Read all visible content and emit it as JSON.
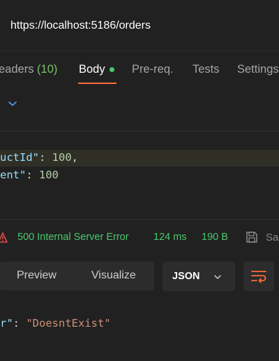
{
  "request": {
    "url": "https://localhost:5186/orders"
  },
  "tabs": [
    {
      "label": "eaders",
      "count": "(10)"
    },
    {
      "label": "Body"
    },
    {
      "label": "Pre-req."
    },
    {
      "label": "Tests"
    },
    {
      "label": "Settings"
    }
  ],
  "request_body": {
    "line1_key": "uctId\"",
    "line1_sep": ": ",
    "line1_value": "100",
    "line1_tail": ",",
    "line2_key": "ent\"",
    "line2_sep": ": ",
    "line2_value": "100"
  },
  "response": {
    "status": "500 Internal Server Error",
    "time": "124 ms",
    "size": "190 B",
    "save_label": "Sa",
    "view_tabs": [
      "Preview",
      "Visualize"
    ],
    "format": "JSON",
    "body_key": "r\"",
    "body_sep": ": ",
    "body_value": "\"DoesntExist\""
  },
  "colors": {
    "accent": "#ff6c37",
    "success": "#49c86b",
    "error": "#e04a4a"
  },
  "icons": {
    "expand": "chevron-down-icon",
    "status": "error-warning-icon",
    "save": "save-icon",
    "format_dropdown": "chevron-down-icon",
    "wrap": "wrap-lines-icon"
  }
}
